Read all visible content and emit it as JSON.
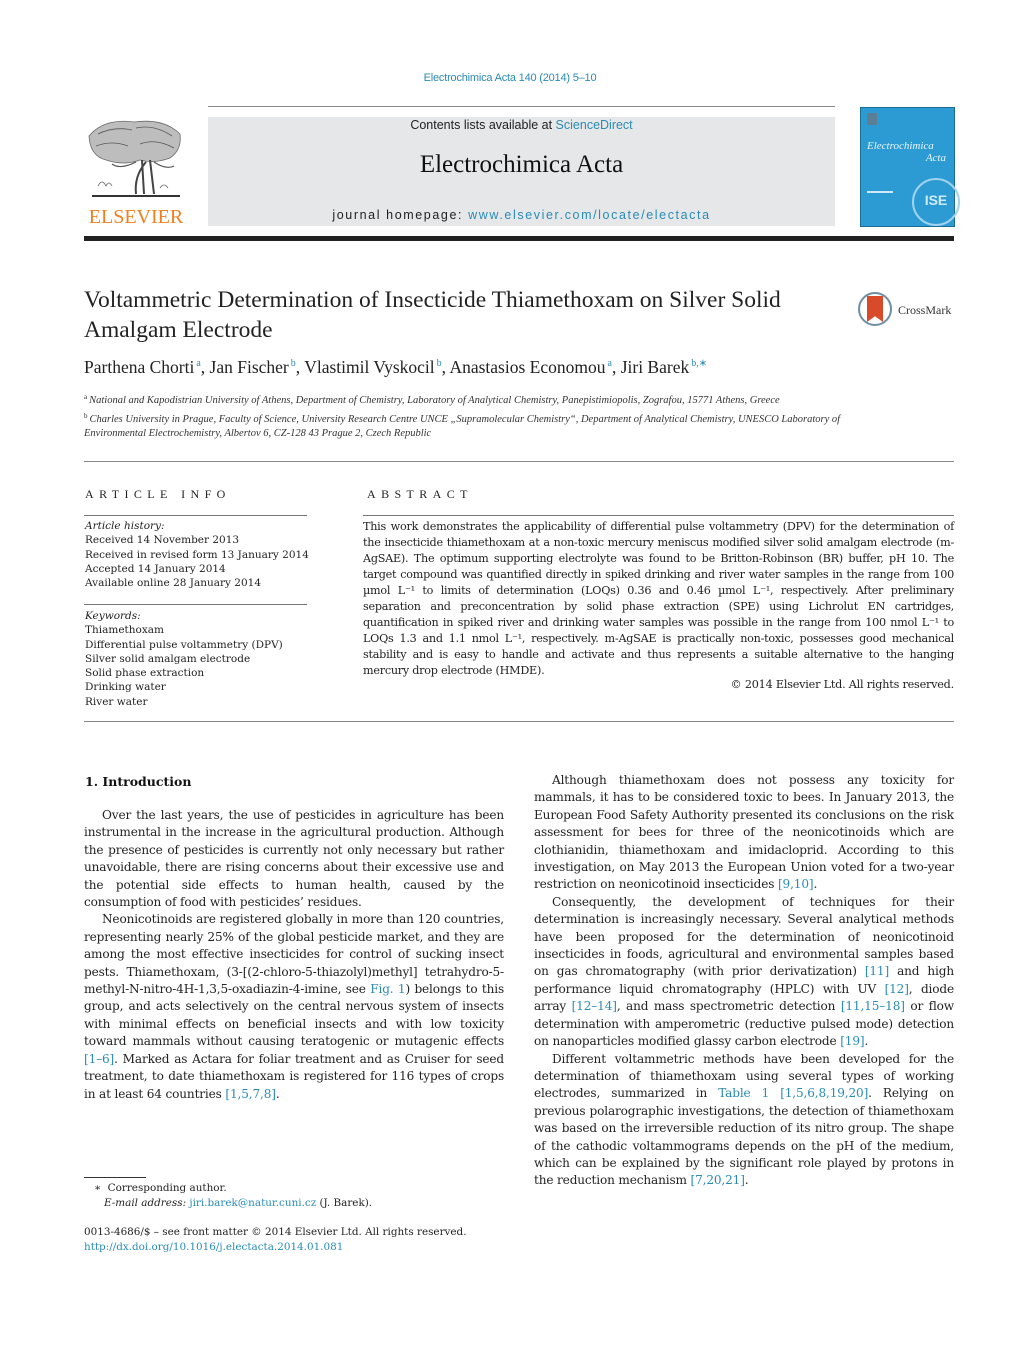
{
  "header": {
    "journal_ref": "Electrochimica Acta 140 (2014) 5–10",
    "contents_prefix": "Contents lists available at ",
    "contents_link": "ScienceDirect",
    "journal_name": "Electrochimica Acta",
    "homepage_prefix": "journal homepage: ",
    "homepage_link": "www.elsevier.com/locate/electacta",
    "publisher_logo_text": "ELSEVIER",
    "cover_title": "Electrochimica",
    "cover_subtitle": "Acta",
    "cover_badge": "ISE",
    "colors": {
      "link": "#2a8bb5",
      "elsevier_orange": "#f07f1d",
      "cover_blue": "#2c9ad3",
      "banner_gray": "#e6e7e8"
    }
  },
  "article": {
    "title": "Voltammetric Determination of Insecticide Thiamethoxam on Silver Solid Amalgam Electrode",
    "crossmark_label": "CrossMark",
    "authors": [
      {
        "name": "Parthena Chorti",
        "sup": "a"
      },
      {
        "name": "Jan Fischer",
        "sup": "b"
      },
      {
        "name": "Vlastimil Vyskocil",
        "sup": "b"
      },
      {
        "name": "Anastasios Economou",
        "sup": "a"
      },
      {
        "name": "Jiri Barek",
        "sup": "b,∗"
      }
    ],
    "affiliations": [
      {
        "sup": "a",
        "text": "National and Kapodistrian University of Athens, Department of Chemistry, Laboratory of Analytical Chemistry, Panepistimiopolis, Zografou, 15771 Athens, Greece"
      },
      {
        "sup": "b",
        "text": "Charles University in Prague, Faculty of Science, University Research Centre UNCE „Supramolecular Chemistry“, Department of Analytical Chemistry, UNESCO Laboratory of Environmental Electrochemistry, Albertov 6, CZ-128 43 Prague 2, Czech Republic"
      }
    ]
  },
  "article_info": {
    "heading": "ARTICLE INFO",
    "history_label": "Article history:",
    "history": [
      "Received 14 November 2013",
      "Received in revised form 13 January 2014",
      "Accepted 14 January 2014",
      "Available online 28 January 2014"
    ],
    "keywords_label": "Keywords:",
    "keywords": [
      "Thiamethoxam",
      "Differential pulse voltammetry (DPV)",
      "Silver solid amalgam electrode",
      "Solid phase extraction",
      "Drinking water",
      "River water"
    ]
  },
  "abstract": {
    "heading": "ABSTRACT",
    "text": "This work demonstrates the applicability of differential pulse voltammetry (DPV) for the determination of the insecticide thiamethoxam at a non-toxic mercury meniscus modified silver solid amalgam electrode (m-AgSAE). The optimum supporting electrolyte was found to be Britton-Robinson (BR) buffer, pH 10. The target compound was quantified directly in spiked drinking and river water samples in the range from 100 µmol L⁻¹ to limits of determination (LOQs) 0.36 and 0.46 µmol L⁻¹, respectively. After preliminary separation and preconcentration by solid phase extraction (SPE) using Lichrolut EN cartridges, quantification in spiked river and drinking water samples was possible in the range from 100 nmol L⁻¹ to LOQs 1.3 and 1.1 nmol L⁻¹, respectively. m-AgSAE is practically non-toxic, possesses good mechanical stability and is easy to handle and activate and thus represents a suitable alternative to the hanging mercury drop electrode (HMDE).",
    "copyright": "© 2014 Elsevier Ltd. All rights reserved."
  },
  "body": {
    "section_heading": "1.  Introduction",
    "left_paragraphs": [
      [
        {
          "t": "Over the last years, the use of pesticides in agriculture has been instrumental in the increase in the agricultural production. Although the presence of pesticides is currently not only necessary but rather unavoidable, there are rising concerns about their excessive use and the potential side effects to human health, caused by the consumption of food with pesticides’ residues."
        }
      ],
      [
        {
          "t": "Neonicotinoids are registered globally in more than 120 countries, representing nearly 25% of the global pesticide market, and they are among the most effective insecticides for control of sucking insect pests. Thiamethoxam, (3-[(2-chloro-5-thiazolyl)methyl]  tetrahydro-5-methyl-N-nitro-4H-1,3,5-oxadiazin-4-imine, see "
        },
        {
          "t": "Fig. 1",
          "link": true
        },
        {
          "t": ") belongs to this group, and acts selectively on the central nervous system of insects with minimal effects on beneficial insects and with low toxicity toward mammals without causing teratogenic or mutagenic effects "
        },
        {
          "t": "[1–6]",
          "link": true
        },
        {
          "t": ". Marked as Actara for foliar treatment and as Cruiser for seed treatment, to date thiamethoxam is registered for 116 types of crops in at least 64 countries "
        },
        {
          "t": "[1,5,7,8]",
          "link": true
        },
        {
          "t": "."
        }
      ]
    ],
    "right_paragraphs": [
      [
        {
          "t": "Although thiamethoxam does not possess any toxicity for mammals, it has to be considered toxic to bees. In January 2013, the European Food Safety Authority presented its conclusions on the risk assessment for bees for three of the neonicotinoids which are clothianidin, thiamethoxam and imidacloprid. According to this investigation, on May 2013 the European Union voted for a two-year restriction on neonicotinoid insecticides "
        },
        {
          "t": "[9,10]",
          "link": true
        },
        {
          "t": "."
        }
      ],
      [
        {
          "t": "Consequently, the development of techniques for their determination is increasingly necessary. Several analytical methods have been proposed for the determination of neonicotinoid insecticides in foods, agricultural and environmental samples based on gas chromatography (with prior derivatization) "
        },
        {
          "t": "[11]",
          "link": true
        },
        {
          "t": " and high performance liquid chromatography (HPLC) with UV "
        },
        {
          "t": "[12]",
          "link": true
        },
        {
          "t": ", diode array "
        },
        {
          "t": "[12–14]",
          "link": true
        },
        {
          "t": ", and mass spectrometric detection "
        },
        {
          "t": "[11,15–18]",
          "link": true
        },
        {
          "t": " or flow determination with amperometric (reductive pulsed mode) detection on nanoparticles modified glassy carbon electrode "
        },
        {
          "t": "[19]",
          "link": true
        },
        {
          "t": "."
        }
      ],
      [
        {
          "t": "Different voltammetric methods have been developed for the determination of thiamethoxam using several types of working electrodes, summarized in "
        },
        {
          "t": "Table 1",
          "link": true
        },
        {
          "t": " "
        },
        {
          "t": "[1,5,6,8,19,20]",
          "link": true
        },
        {
          "t": ". Relying on previous polarographic investigations, the detection of thiamethoxam was based on the irreversible reduction of its nitro group. The shape of the cathodic voltammograms depends on the pH of the medium, which can be explained by the significant role played by protons in the reduction mechanism "
        },
        {
          "t": "[7,20,21]",
          "link": true
        },
        {
          "t": "."
        }
      ]
    ]
  },
  "footnote": {
    "marker": "∗",
    "corresponding": "Corresponding author.",
    "email_label": "E-mail address:",
    "email": "jiri.barek@natur.cuni.cz",
    "email_suffix": " (J. Barek).",
    "issn_line": "0013-4686/$ – see front matter © 2014 Elsevier Ltd. All rights reserved.",
    "doi": "http://dx.doi.org/10.1016/j.electacta.2014.01.081"
  }
}
